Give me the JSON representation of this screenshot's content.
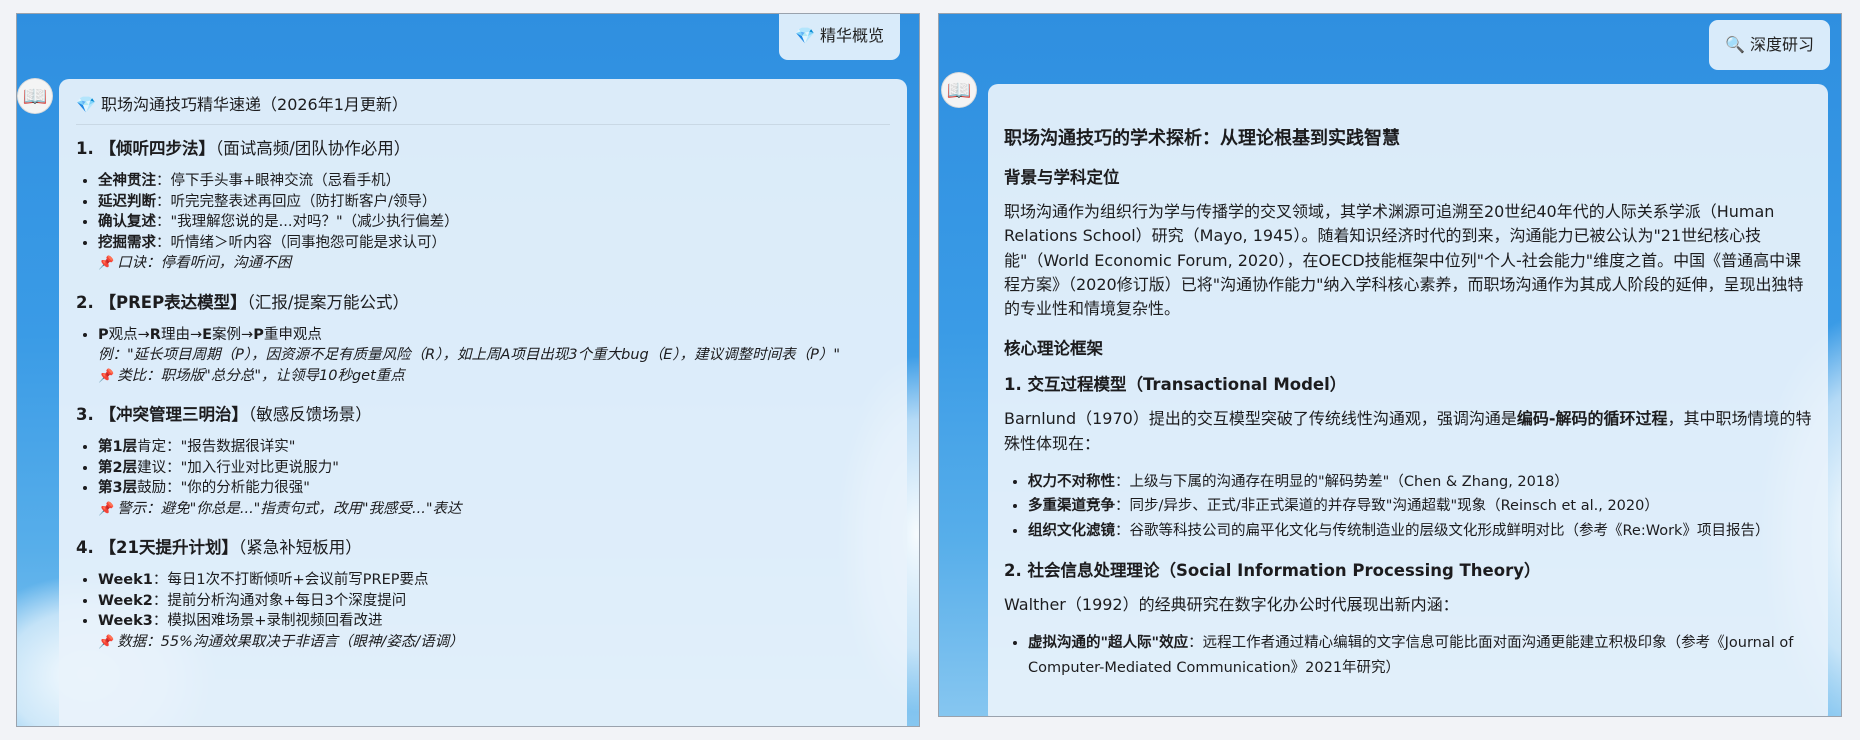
{
  "left": {
    "button_label": "💎 精华概览",
    "title": "💎 职场沟通技巧精华速递（2026年1月更新）",
    "sections": [
      {
        "num": "1. ",
        "name": "【倾听四步法】",
        "note": "（面试高频/团队协作必用）",
        "items": [
          {
            "key": "全神贯注",
            "text": "：停下手头事+眼神交流（忌看手机）"
          },
          {
            "key": "延迟判断",
            "text": "：听完完整表述再回应（防打断客户/领导）"
          },
          {
            "key": "确认复述",
            "text": "：\"我理解您说的是...对吗？\"（减少执行偏差）"
          },
          {
            "key": "挖掘需求",
            "text": "：听情绪＞听内容（同事抱怨可能是求认可）"
          }
        ],
        "extra": [],
        "pin": "口诀：停看听问，沟通不困"
      },
      {
        "num": "2. ",
        "name": "【PREP表达模型】",
        "note": "（汇报/提案万能公式）",
        "prep": {
          "p1": "P",
          "t1": "观点→",
          "r": "R",
          "t2": "理由→",
          "e": "E",
          "t3": "案例→",
          "p2": "P",
          "t4": "重申观点"
        },
        "example": "例：\"延长项目周期（P），因资源不足有质量风险（R），如上周A项目出现3个重大bug（E），建议调整时间表（P）\"",
        "pin": "类比：职场版\"总分总\"，让领导10秒get重点"
      },
      {
        "num": "3. ",
        "name": "【冲突管理三明治】",
        "note": "（敏感反馈场景）",
        "items": [
          {
            "key": "第1层",
            "text": "肯定：\"报告数据很详实\""
          },
          {
            "key": "第2层",
            "text": "建议：\"加入行业对比更说服力\""
          },
          {
            "key": "第3层",
            "text": "鼓励：\"你的分析能力很强\""
          }
        ],
        "pin": "警示：避免\"你总是...\"指责句式，改用\"我感受...\"表达"
      },
      {
        "num": "4. ",
        "name": "【21天提升计划】",
        "note": "（紧急补短板用）",
        "items": [
          {
            "key": "Week1",
            "text": "：每日1次不打断倾听+会议前写PREP要点"
          },
          {
            "key": "Week2",
            "text": "：提前分析沟通对象+每日3个深度提问"
          },
          {
            "key": "Week3",
            "text": "：模拟困难场景+录制视频回看改进"
          }
        ],
        "pin": "数据：55%沟通效果取决于非语言（眼神/姿态/语调）"
      }
    ]
  },
  "right": {
    "button_label": "🔍 深度研习",
    "title": "职场沟通技巧的学术探析：从理论根基到实践智慧",
    "h_background": "背景与学科定位",
    "p_background": "职场沟通作为组织行为学与传播学的交叉领域，其学术渊源可追溯至20世纪40年代的人际关系学派（Human Relations School）研究（Mayo, 1945）。随着知识经济时代的到来，沟通能力已被公认为\"21世纪核心技能\"（World Economic Forum, 2020），在OECD技能框架中位列\"个人-社会能力\"维度之首。中国《普通高中课程方案》（2020修订版）已将\"沟通协作能力\"纳入学科核心素养，而职场沟通作为其成人阶段的延伸，呈现出独特的专业性和情境复杂性。",
    "h_framework": "核心理论框架",
    "h_model1": "1. 交互过程模型（Transactional Model）",
    "p_model1_a": "Barnlund（1970）提出的交互模型突破了传统线性沟通观，强调沟通是",
    "p_model1_b": "编码-解码的循环过程",
    "p_model1_c": "，其中职场情境的特殊性体现在：",
    "model1_items": [
      {
        "key": "权力不对称性",
        "text": "：上级与下属的沟通存在明显的\"解码势差\"（Chen & Zhang, 2018）"
      },
      {
        "key": "多重渠道竞争",
        "text": "：同步/异步、正式/非正式渠道的并存导致\"沟通超载\"现象（Reinsch et al., 2020）"
      },
      {
        "key": "组织文化滤镜",
        "text": "：谷歌等科技公司的扁平化文化与传统制造业的层级文化形成鲜明对比（参考《Re:Work》项目报告）"
      }
    ],
    "h_model2": "2. 社会信息处理理论（Social Information Processing Theory）",
    "p_model2": "Walther（1992）的经典研究在数字化办公时代展现出新内涵：",
    "model2_items": [
      {
        "key": "虚拟沟通的\"超人际\"效应",
        "text": "：远程工作者通过精心编辑的文字信息可能比面对面沟通更能建立积极印象（参考《Journal of Computer-Mediated Communication》2021年研究）"
      }
    ]
  }
}
